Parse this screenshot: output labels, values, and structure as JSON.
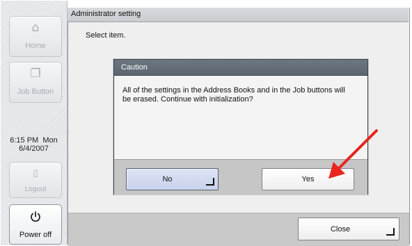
{
  "window": {
    "title": "Administrator setting"
  },
  "instruction": "Select item.",
  "sidebar": {
    "home_label": "Home",
    "job_button_label": "Job Button",
    "clock": {
      "time": "6:15 PM  Mon",
      "date": "6/4/2007"
    },
    "logout_label": "Logout",
    "power_label": "Power off"
  },
  "dialog": {
    "title": "Caution",
    "message": "All of the settings in the Address Books and in the Job buttons will be erased.  Continue with initialization?",
    "no_label": "No",
    "yes_label": "Yes"
  },
  "footer": {
    "close_label": "Close"
  },
  "icons": {
    "home": "home-icon",
    "job_button": "document-icon",
    "logout": "logout-icon",
    "power": "power-icon",
    "enter": "enter-arrow-icon"
  },
  "colors": {
    "dialog_title_bg": "#5f6a74",
    "no_button_bg": "#cdd6ee",
    "annotation_arrow": "#e8261e"
  }
}
